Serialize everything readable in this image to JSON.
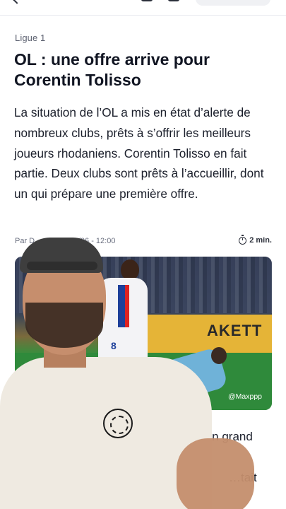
{
  "article": {
    "category": "Ligue 1",
    "title": "OL : une offre arrive pour Corentin Tolisso",
    "lead": "La situation de l’OL a mis en état d’alerte de nombreux clubs, prêts à s’offrir les meilleurs joueurs rhodaniens. Corentin Tolisso en fait partie. Deux clubs sont prêts à l’accueillir, dont un qui prépare une première offre.",
    "byline": "Par D… …abi - 26/06 - 12:00",
    "read_time": "2 min.",
    "image_credit": "@Maxppp",
    "board_text": "AKETT",
    "shirt_number": "8",
    "body_line1": "…it son grand",
    "body_line3": "…tait"
  },
  "icons": {
    "back": "chevron-left-icon",
    "read_time": "stopwatch-icon"
  }
}
